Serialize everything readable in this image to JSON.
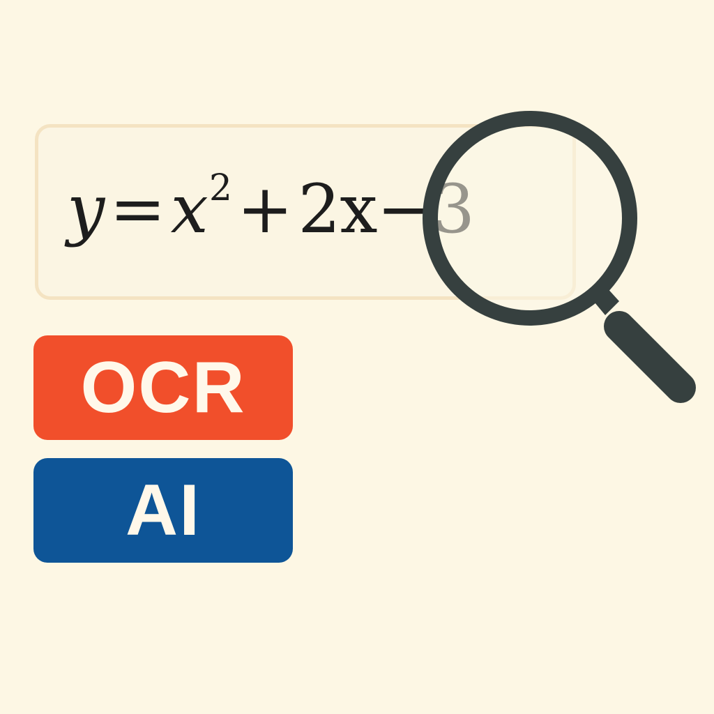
{
  "formula": {
    "y": "y",
    "equals": "=",
    "x": "x",
    "exponent": "2",
    "plus": "+",
    "term": "2x",
    "minus": "−3"
  },
  "badges": {
    "ocr_label": "OCR",
    "ai_label": "AI"
  },
  "icons": {
    "magnifier": "magnifying-glass-icon"
  },
  "colors": {
    "background": "#fdf7e4",
    "ocr_badge": "#f14f2b",
    "ai_badge": "#0e5597",
    "magnifier": "#36403f",
    "badge_text": "#fff8ea"
  }
}
